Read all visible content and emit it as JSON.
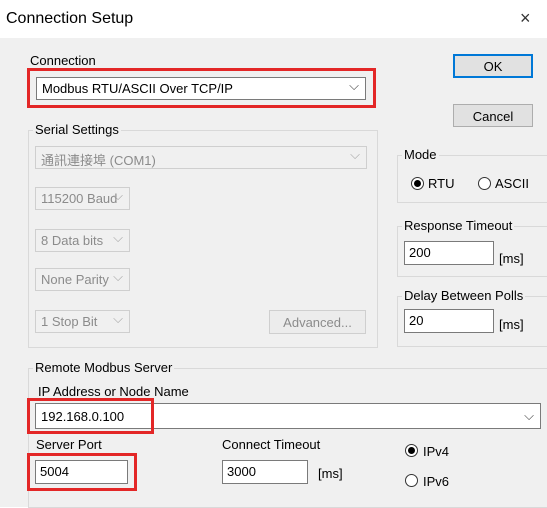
{
  "window": {
    "title": "Connection Setup",
    "close_glyph": "×"
  },
  "connection": {
    "label": "Connection",
    "selected": "Modbus RTU/ASCII Over TCP/IP"
  },
  "buttons": {
    "ok": "OK",
    "cancel": "Cancel",
    "advanced": "Advanced..."
  },
  "serial": {
    "label": "Serial Settings",
    "port": "通訊連接埠 (COM1)",
    "baud": "115200 Baud",
    "data_bits": "8 Data bits",
    "parity": "None Parity",
    "stop_bits": "1 Stop Bit"
  },
  "mode": {
    "label": "Mode",
    "rtu": "RTU",
    "ascii": "ASCII",
    "selected": "RTU"
  },
  "response_timeout": {
    "label": "Response Timeout",
    "value": "200",
    "unit": "[ms]"
  },
  "delay_polls": {
    "label": "Delay Between Polls",
    "value": "20",
    "unit": "[ms]"
  },
  "remote": {
    "label": "Remote Modbus Server",
    "ip_label": "IP Address or Node Name",
    "ip_value": "192.168.0.100",
    "port_label": "Server Port",
    "port_value": "5004",
    "connect_timeout_label": "Connect Timeout",
    "connect_timeout_value": "3000",
    "connect_timeout_unit": "[ms]",
    "ipv4": "IPv4",
    "ipv6": "IPv6",
    "ip_version_selected": "IPv4"
  },
  "icons": {
    "dropdown": "chevron-down-icon",
    "close": "close-icon"
  },
  "colors": {
    "highlight": "#e32727",
    "default_button_border": "#0078d7",
    "dialog_bg": "#f0f0f0"
  }
}
